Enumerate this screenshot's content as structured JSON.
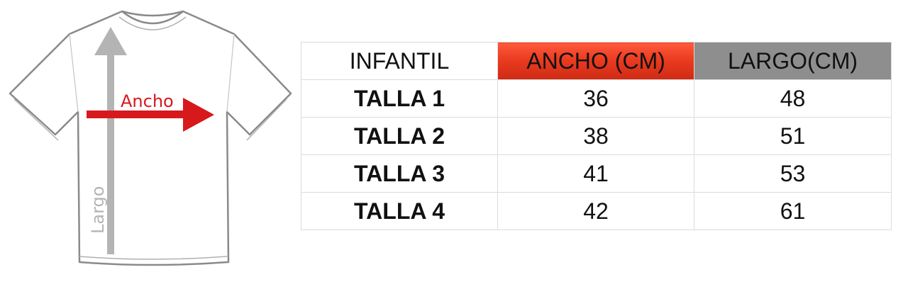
{
  "illustration": {
    "width_label": "Ancho",
    "length_label": "Largo",
    "colors": {
      "width_arrow": "#d7191c",
      "length_arrow": "#b4b4b4",
      "shirt_outline": "#8a8a8a"
    }
  },
  "table": {
    "headers": [
      "INFANTIL",
      "ANCHO (CM)",
      "LARGO(CM)"
    ],
    "rows": [
      {
        "label": "TALLA 1",
        "ancho": "36",
        "largo": "48"
      },
      {
        "label": "TALLA 2",
        "ancho": "38",
        "largo": "51"
      },
      {
        "label": "TALLA 3",
        "ancho": "41",
        "largo": "53"
      },
      {
        "label": "TALLA 4",
        "ancho": "42",
        "largo": "61"
      }
    ],
    "colors": {
      "ancho_header": "#e63a1f",
      "largo_header": "#8e8e8e",
      "border": "#dcdcdc"
    }
  }
}
